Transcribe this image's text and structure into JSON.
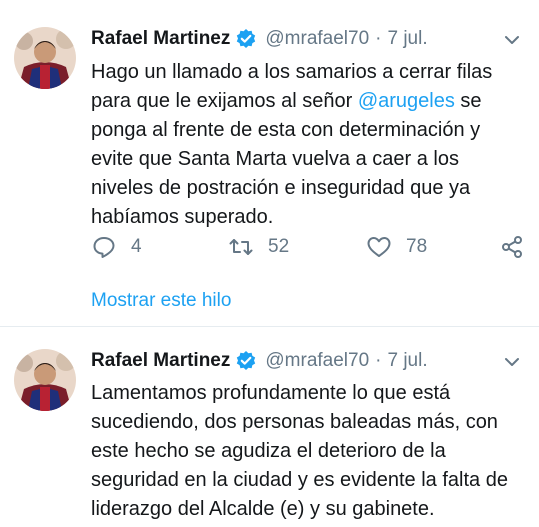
{
  "tweets": [
    {
      "author": {
        "name": "Rafael Martinez",
        "handle": "@mrafael70",
        "verified": true
      },
      "separator": "·",
      "date": "7 jul.",
      "lines": [
        "Hago un llamado a los samarios a cerrar filas",
        "para que le exijamos al señor ",
        "ponga al frente de esta con determinación y",
        "evite que Santa Marta vuelva a caer a los",
        "niveles de postración e inseguridad que ya",
        "habíamos superado."
      ],
      "mention": "@arugeles",
      "mention_suffix": " se",
      "actions": {
        "replies": "4",
        "retweets": "52",
        "likes": "78"
      },
      "show_thread": "Mostrar este hilo"
    },
    {
      "author": {
        "name": "Rafael Martinez",
        "handle": "@mrafael70",
        "verified": true
      },
      "separator": "·",
      "date": "7 jul.",
      "lines": [
        "Lamentamos profundamente lo que está",
        "sucediendo, dos personas baleadas más, con",
        "este hecho se agudiza el deterioro de la",
        "seguridad en la ciudad y es evidente la falta de",
        "liderazgo del Alcalde (e) y su gabinete."
      ]
    }
  ],
  "colors": {
    "accent": "#1da1f2",
    "muted": "#657786",
    "text": "#14171a",
    "divider": "#e6ecf0"
  },
  "icons": [
    "verified-badge-icon",
    "chevron-down-icon",
    "reply-icon",
    "retweet-icon",
    "like-icon",
    "share-icon"
  ]
}
